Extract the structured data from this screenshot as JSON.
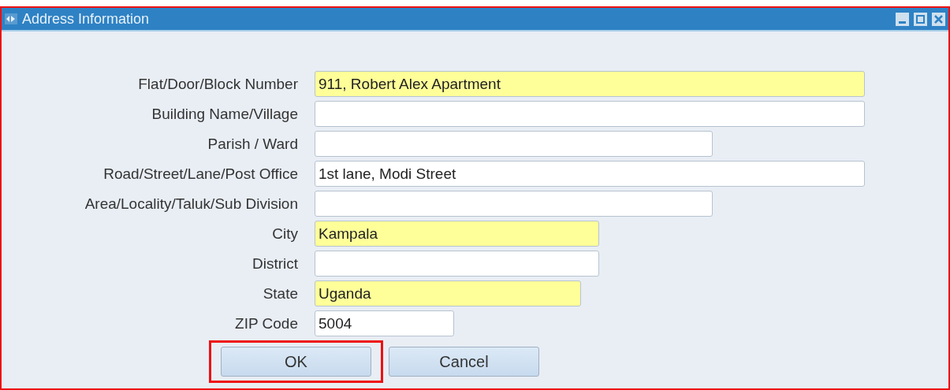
{
  "window": {
    "title": "Address Information",
    "highlighted": true
  },
  "fields": [
    {
      "label": "Flat/Door/Block Number",
      "value": "911, Robert Alex Apartment",
      "required": true
    },
    {
      "label": "Building Name/Village",
      "required": false
    },
    {
      "label": "Parish / Ward",
      "required": false
    },
    {
      "label": "Road/Street/Lane/Post Office",
      "value": "1st lane, Modi Street",
      "required": false
    },
    {
      "label": "Area/Locality/Taluk/Sub Division",
      "required": false
    },
    {
      "label": "City",
      "value": "Kampala",
      "required": true
    },
    {
      "label": "District",
      "required": false
    },
    {
      "label": "State",
      "value": "Uganda",
      "required": true
    },
    {
      "label": "ZIP Code",
      "value": "5004",
      "required": false
    }
  ],
  "buttons": [
    {
      "label": "OK",
      "highlighted": true
    },
    {
      "label": "Cancel",
      "highlighted": false
    }
  ]
}
